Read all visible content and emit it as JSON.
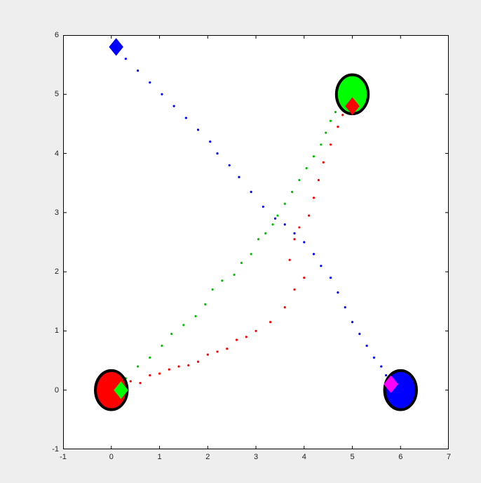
{
  "chart_data": {
    "type": "scatter",
    "title": "",
    "xlabel": "",
    "ylabel": "",
    "xlim": [
      -1,
      7
    ],
    "ylim": [
      -1,
      6
    ],
    "xticks": [
      -1,
      0,
      1,
      2,
      3,
      4,
      5,
      6,
      7
    ],
    "yticks": [
      -1,
      0,
      1,
      2,
      3,
      4,
      5,
      6
    ],
    "xtick_labels": [
      "-1",
      "0",
      "1",
      "2",
      "3",
      "4",
      "5",
      "6",
      "7"
    ],
    "ytick_labels": [
      "-1",
      "0",
      "1",
      "2",
      "3",
      "4",
      "5",
      "6"
    ],
    "circles": [
      {
        "name": "bottom-left-circle",
        "x": 0.0,
        "y": 0.0,
        "r": 0.33,
        "fill": "#ff0000",
        "stroke": "#000000"
      },
      {
        "name": "top-right-circle",
        "x": 5.0,
        "y": 5.0,
        "r": 0.33,
        "fill": "#00ff00",
        "stroke": "#000000"
      },
      {
        "name": "bottom-right-circle",
        "x": 6.0,
        "y": 0.0,
        "r": 0.33,
        "fill": "#0000ff",
        "stroke": "#000000"
      }
    ],
    "diamonds": [
      {
        "name": "top-left-diamond",
        "x": 0.1,
        "y": 5.8,
        "size": 0.14,
        "fill": "#0000ff"
      },
      {
        "name": "green-diamond-bl",
        "x": 0.2,
        "y": 0.0,
        "size": 0.14,
        "fill": "#00ff00"
      },
      {
        "name": "red-diamond-tr",
        "x": 5.0,
        "y": 4.8,
        "size": 0.14,
        "fill": "#ff0000"
      },
      {
        "name": "magenta-diamond-br",
        "x": 5.8,
        "y": 0.1,
        "size": 0.14,
        "fill": "#ff00ff"
      }
    ],
    "series": [
      {
        "name": "red-path",
        "color": "#ff0000",
        "points": [
          [
            0.2,
            0.1
          ],
          [
            0.4,
            0.15
          ],
          [
            0.6,
            0.12
          ],
          [
            0.8,
            0.25
          ],
          [
            1.0,
            0.28
          ],
          [
            1.2,
            0.35
          ],
          [
            1.4,
            0.4
          ],
          [
            1.6,
            0.42
          ],
          [
            1.8,
            0.48
          ],
          [
            2.0,
            0.6
          ],
          [
            2.2,
            0.65
          ],
          [
            2.4,
            0.7
          ],
          [
            2.6,
            0.85
          ],
          [
            2.8,
            0.9
          ],
          [
            3.0,
            1.0
          ],
          [
            3.3,
            1.15
          ],
          [
            3.6,
            1.4
          ],
          [
            3.8,
            1.7
          ],
          [
            4.0,
            1.9
          ],
          [
            3.7,
            2.2
          ],
          [
            3.8,
            2.55
          ],
          [
            3.9,
            2.75
          ],
          [
            4.1,
            2.95
          ],
          [
            4.2,
            3.25
          ],
          [
            4.3,
            3.55
          ],
          [
            4.4,
            3.85
          ],
          [
            4.55,
            4.15
          ],
          [
            4.7,
            4.45
          ],
          [
            4.8,
            4.65
          ],
          [
            4.9,
            4.75
          ]
        ]
      },
      {
        "name": "green-path",
        "color": "#00c000",
        "points": [
          [
            0.3,
            0.2
          ],
          [
            0.55,
            0.4
          ],
          [
            0.8,
            0.55
          ],
          [
            1.05,
            0.75
          ],
          [
            1.25,
            0.95
          ],
          [
            1.5,
            1.1
          ],
          [
            1.75,
            1.25
          ],
          [
            1.95,
            1.45
          ],
          [
            2.1,
            1.7
          ],
          [
            2.3,
            1.85
          ],
          [
            2.55,
            1.95
          ],
          [
            2.7,
            2.15
          ],
          [
            2.9,
            2.3
          ],
          [
            3.05,
            2.55
          ],
          [
            3.2,
            2.65
          ],
          [
            3.35,
            2.8
          ],
          [
            3.45,
            2.95
          ],
          [
            3.6,
            3.15
          ],
          [
            3.75,
            3.35
          ],
          [
            3.9,
            3.55
          ],
          [
            4.05,
            3.75
          ],
          [
            4.2,
            3.95
          ],
          [
            4.35,
            4.15
          ],
          [
            4.45,
            4.35
          ],
          [
            4.55,
            4.55
          ],
          [
            4.65,
            4.7
          ],
          [
            4.75,
            4.8
          ],
          [
            4.85,
            4.88
          ]
        ]
      },
      {
        "name": "blue-path",
        "color": "#0000ff",
        "points": [
          [
            0.3,
            5.6
          ],
          [
            0.55,
            5.4
          ],
          [
            0.8,
            5.2
          ],
          [
            1.05,
            5.0
          ],
          [
            1.3,
            4.8
          ],
          [
            1.55,
            4.6
          ],
          [
            1.8,
            4.4
          ],
          [
            2.05,
            4.2
          ],
          [
            2.2,
            4.0
          ],
          [
            2.45,
            3.8
          ],
          [
            2.65,
            3.6
          ],
          [
            2.9,
            3.35
          ],
          [
            3.15,
            3.1
          ],
          [
            3.4,
            2.9
          ],
          [
            3.6,
            2.8
          ],
          [
            3.8,
            2.65
          ],
          [
            4.0,
            2.5
          ],
          [
            4.2,
            2.3
          ],
          [
            4.35,
            2.1
          ],
          [
            4.55,
            1.9
          ],
          [
            4.7,
            1.65
          ],
          [
            4.85,
            1.4
          ],
          [
            5.0,
            1.15
          ],
          [
            5.15,
            0.95
          ],
          [
            5.3,
            0.75
          ],
          [
            5.45,
            0.55
          ],
          [
            5.6,
            0.4
          ],
          [
            5.7,
            0.25
          ],
          [
            5.78,
            0.15
          ]
        ]
      }
    ]
  },
  "layout": {
    "axes_left": 90,
    "axes_top": 50,
    "axes_width": 550,
    "axes_height": 590
  }
}
